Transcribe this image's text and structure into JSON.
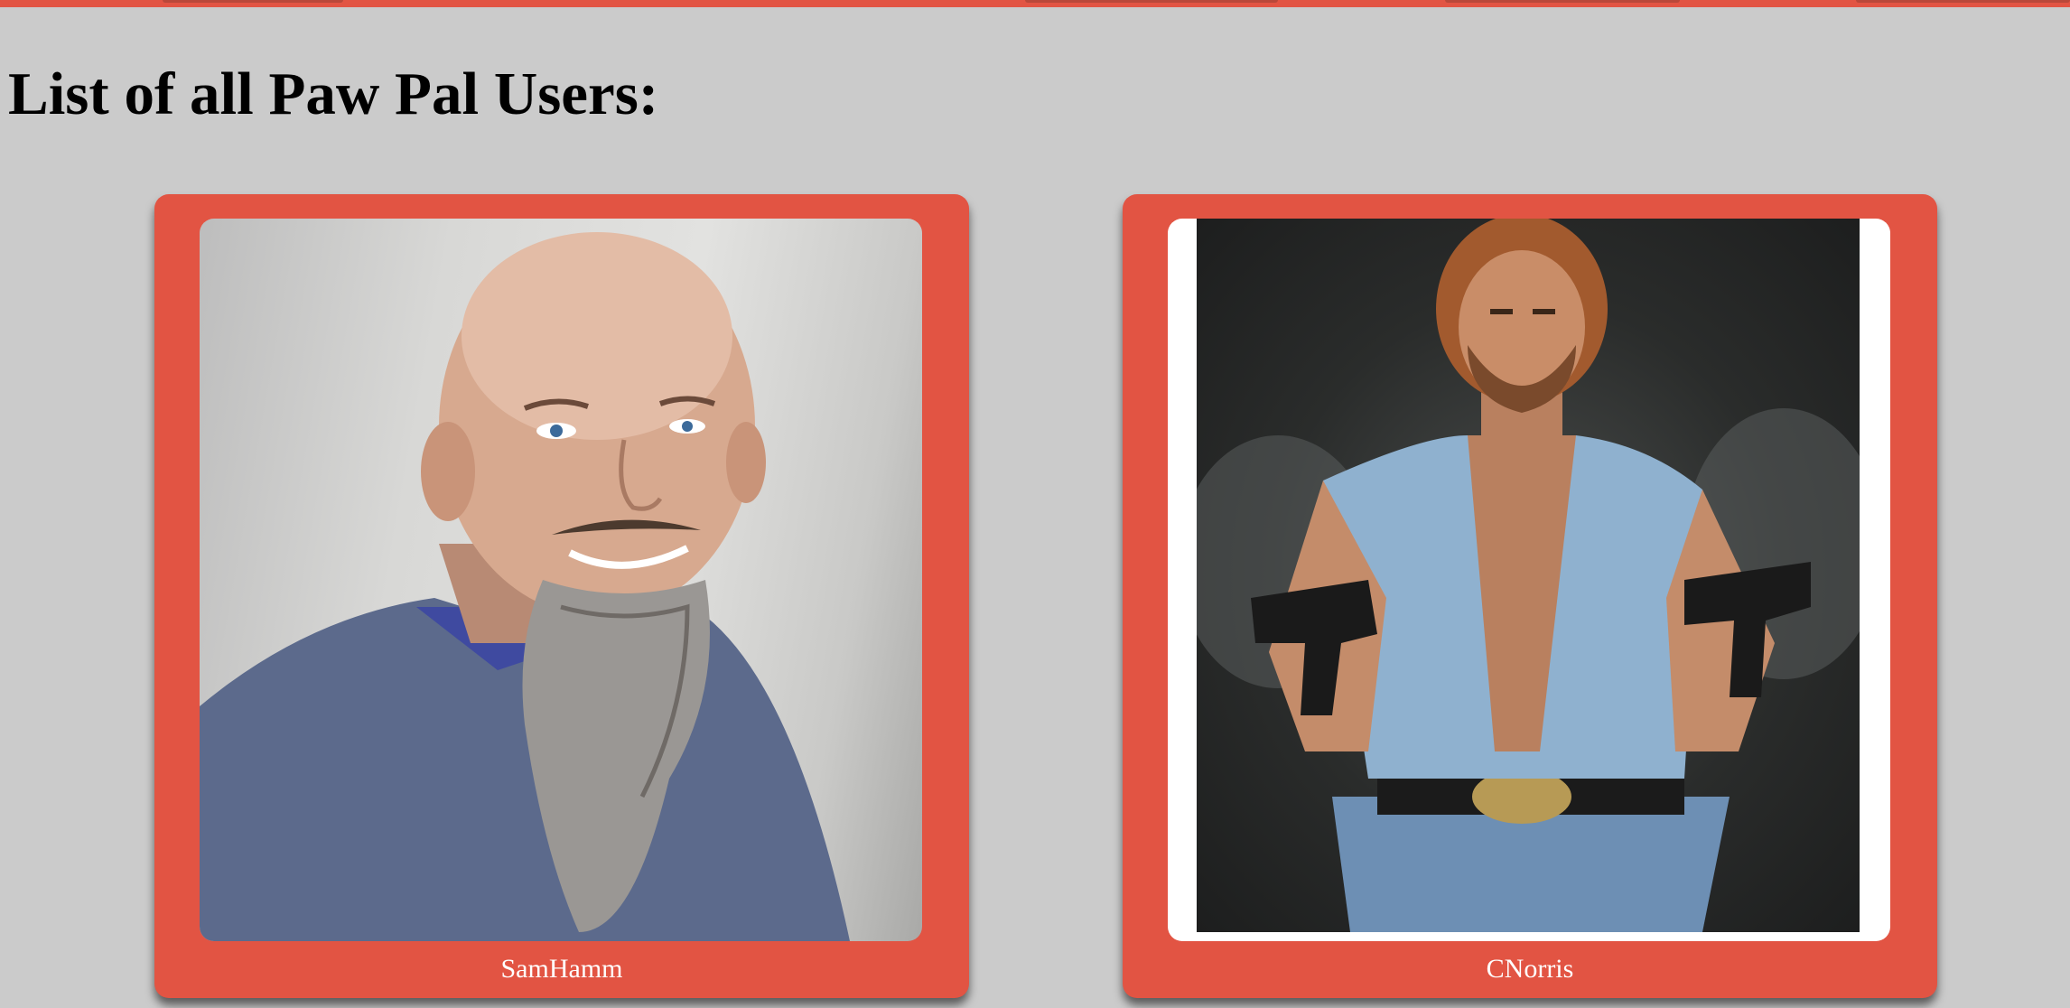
{
  "page": {
    "title": "List of all Paw Pal Users:"
  },
  "users": [
    {
      "username": "SamHamm"
    },
    {
      "username": "CNorris"
    }
  ],
  "colors": {
    "background": "#cbcbcb",
    "accent": "#e25443",
    "caption_text": "#ffffff"
  }
}
